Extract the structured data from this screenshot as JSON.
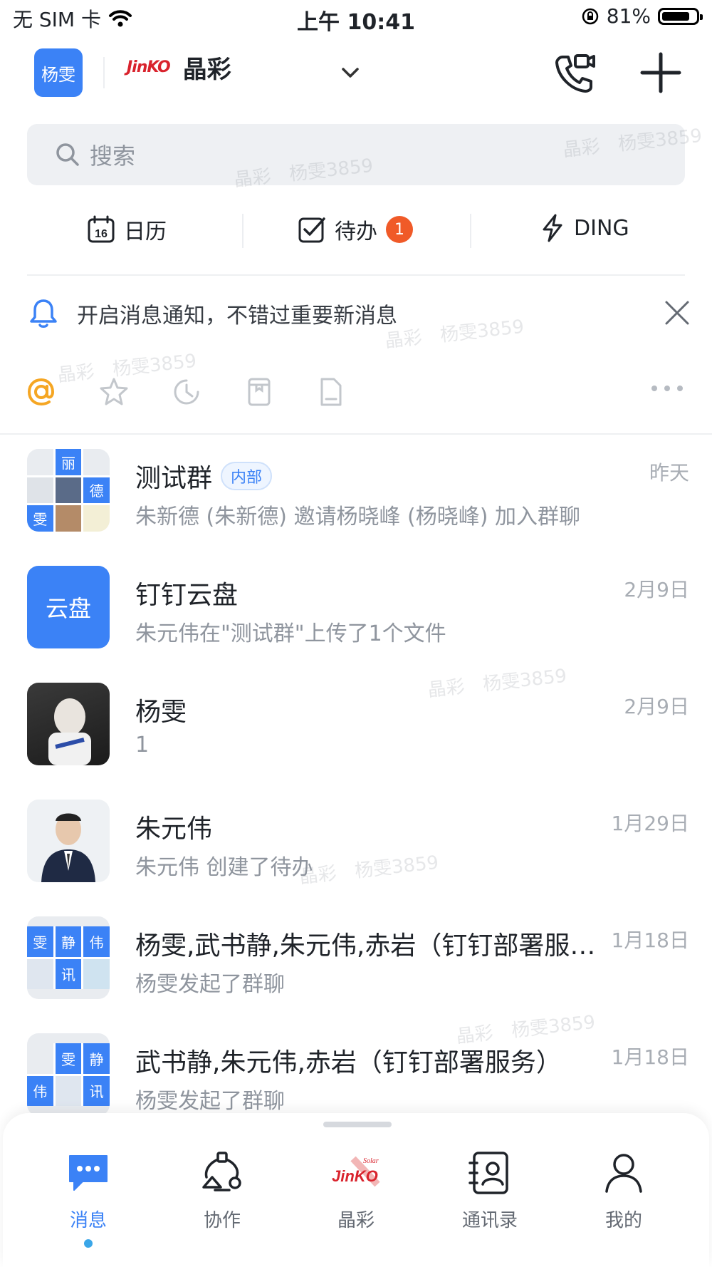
{
  "status": {
    "carrier": "无 SIM 卡",
    "time": "上午 10:41",
    "battery": "81%"
  },
  "header": {
    "user_badge": "杨雯",
    "org_name": "晶彩",
    "org_logo_text": "JinKO",
    "org_logo_sub": "Solar"
  },
  "search": {
    "placeholder": "搜索"
  },
  "quick": {
    "calendar": {
      "label": "日历",
      "day": "16"
    },
    "todo": {
      "label": "待办",
      "badge": "1"
    },
    "ding": {
      "label": "DING"
    }
  },
  "notice": {
    "text": "开启消息通知，不错过重要新消息"
  },
  "chats": [
    {
      "title": "测试群",
      "tag": "内部",
      "subtitle": "朱新德 (朱新德) 邀请杨晓峰 (杨晓峰) 加入群聊",
      "time": "昨天",
      "avatar_cells": [
        "丽",
        "德",
        "雯"
      ]
    },
    {
      "title": "钉钉云盘",
      "subtitle": "朱元伟在\"测试群\"上传了1个文件",
      "time": "2月9日",
      "avatar_text": "云盘"
    },
    {
      "title": "杨雯",
      "subtitle": "1",
      "time": "2月9日"
    },
    {
      "title": "朱元伟",
      "subtitle": "朱元伟 创建了待办",
      "time": "1月29日"
    },
    {
      "title": "杨雯,武书静,朱元伟,赤岩（钉钉部署服务）",
      "subtitle": "杨雯发起了群聊",
      "time": "1月18日",
      "avatar_cells": [
        "雯",
        "静",
        "伟",
        "讯"
      ]
    },
    {
      "title": "武书静,朱元伟,赤岩（钉钉部署服务）",
      "subtitle": "杨雯发起了群聊",
      "time": "1月18日",
      "avatar_cells": [
        "雯",
        "静",
        "伟",
        "讯"
      ]
    }
  ],
  "watermark": {
    "org": "晶彩",
    "user": "杨雯3859"
  },
  "nav": [
    {
      "label": "消息"
    },
    {
      "label": "协作"
    },
    {
      "label": "晶彩"
    },
    {
      "label": "通讯录"
    },
    {
      "label": "我的"
    }
  ],
  "colors": {
    "accent": "#3b82f6",
    "badge": "#f05a28",
    "brand_red": "#d9232d"
  }
}
